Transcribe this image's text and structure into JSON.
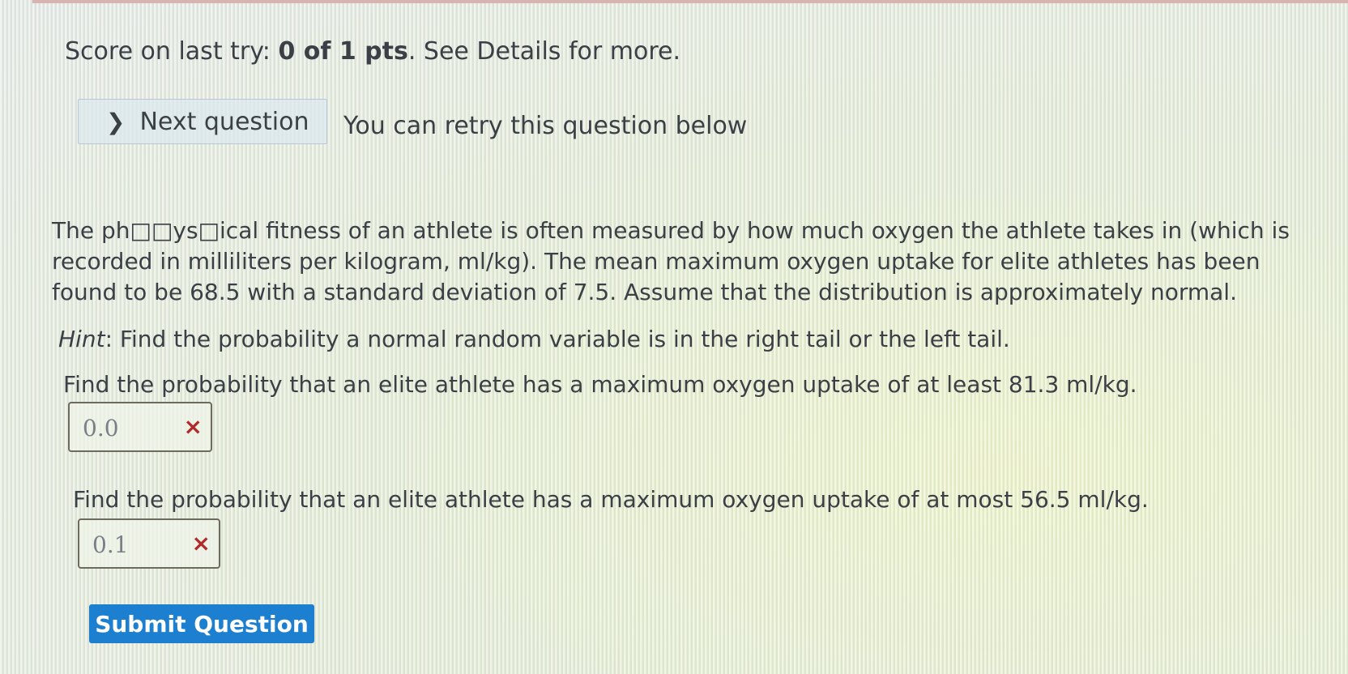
{
  "score": {
    "prefix": "Score on last try: ",
    "points": "0 of 1 pts",
    "suffix": ". See Details for more."
  },
  "nav": {
    "next_label": "Next question",
    "retry_text": "You can retry this question below"
  },
  "question": {
    "text": "The ph□□ys□ical fitness of an athlete is often measured by how much oxygen the athlete takes in (which is recorded in milliliters per kilogram, ml/kg). The mean maximum oxygen uptake for elite athletes has been found to be 68.5 with a standard deviation of 7.5. Assume that the distribution is approximately normal.",
    "hint_label": "Hint",
    "hint_text": ": Find the probability a normal random variable is in the right tail or the left tail."
  },
  "parts": [
    {
      "prompt": "Find the probability that an elite athlete has a maximum oxygen uptake of at least 81.3 ml/kg.",
      "answer": "0.0",
      "status_mark": "×"
    },
    {
      "prompt": "Find the probability that an elite athlete has a maximum oxygen uptake of at most 56.5 ml/kg.",
      "answer": "0.1",
      "status_mark": "×"
    }
  ],
  "submit_label": "Submit Question",
  "colors": {
    "submit_bg": "#1d7fd0",
    "incorrect": "#b02a2a"
  },
  "icons": {
    "next": "chevron-right-icon",
    "incorrect": "incorrect-x-icon"
  }
}
